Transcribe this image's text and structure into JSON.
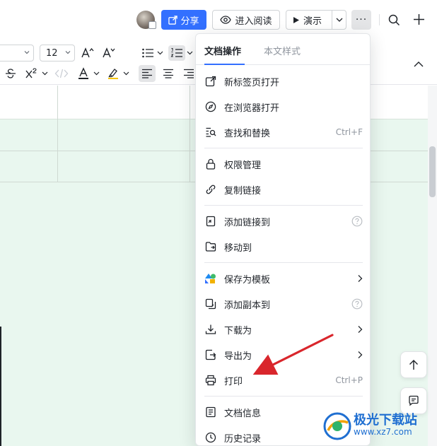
{
  "header": {
    "share_label": "分享",
    "read_label": "进入阅读",
    "present_label": "演示",
    "more_label": "···"
  },
  "toolbar": {
    "font_size": "12"
  },
  "menu": {
    "tabs": [
      {
        "label": "文档操作",
        "active": true
      },
      {
        "label": "本文样式",
        "active": false
      }
    ],
    "items": [
      {
        "label": "新标签页打开",
        "icon": "open-new-tab-icon"
      },
      {
        "label": "在浏览器打开",
        "icon": "compass-icon"
      },
      {
        "label": "查找和替换",
        "icon": "find-replace-icon",
        "shortcut": "Ctrl+F"
      },
      {
        "label": "权限管理",
        "icon": "lock-icon"
      },
      {
        "label": "复制链接",
        "icon": "link-icon"
      },
      {
        "label": "添加链接到",
        "icon": "add-link-icon",
        "help": true
      },
      {
        "label": "移动到",
        "icon": "folder-move-icon"
      },
      {
        "label": "保存为模板",
        "icon": "template-icon",
        "submenu": true
      },
      {
        "label": "添加副本到",
        "icon": "copy-icon",
        "help": true
      },
      {
        "label": "下载为",
        "icon": "download-icon",
        "submenu": true
      },
      {
        "label": "导出为",
        "icon": "export-icon",
        "submenu": true
      },
      {
        "label": "打印",
        "icon": "printer-icon",
        "shortcut": "Ctrl+P"
      },
      {
        "label": "文档信息",
        "icon": "doc-info-icon"
      },
      {
        "label": "历史记录",
        "icon": "history-icon"
      }
    ]
  },
  "colors": {
    "accent": "#3370ff",
    "doc_background": "#e9f7ef",
    "annotation_arrow": "#d9262c"
  },
  "watermark": {
    "title": "极光下载站",
    "url": "www.xz7.com"
  }
}
